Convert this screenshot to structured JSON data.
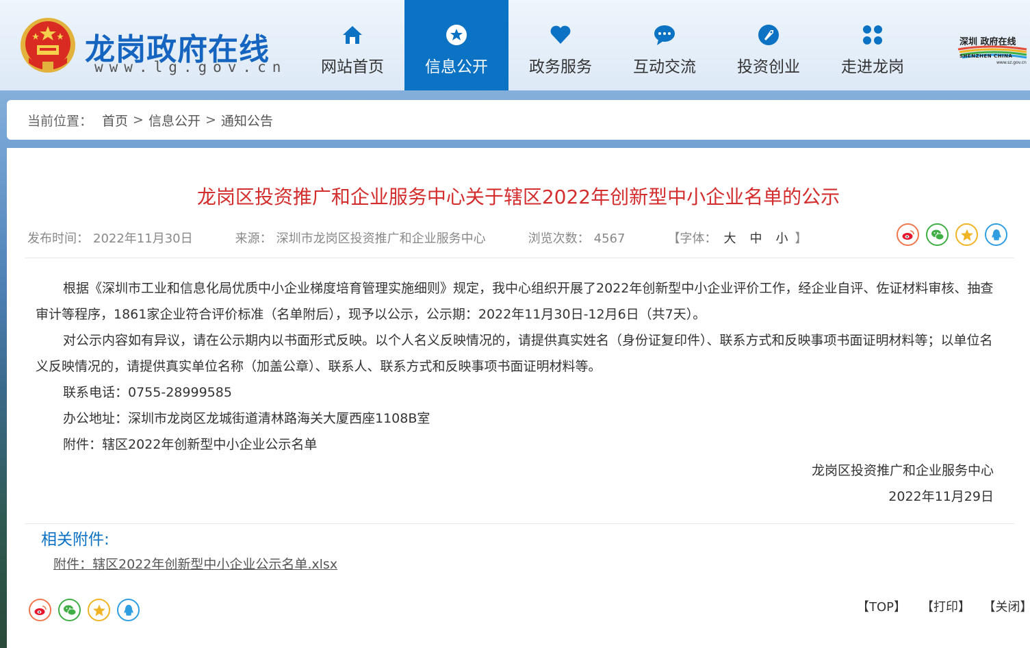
{
  "header": {
    "site_title": "龙岗政府在线",
    "site_url": "www.lg.gov.cn",
    "nav": [
      {
        "label": "网站首页",
        "icon": "home-icon",
        "active": false
      },
      {
        "label": "信息公开",
        "icon": "info-icon",
        "active": true
      },
      {
        "label": "政务服务",
        "icon": "heart-icon",
        "active": false
      },
      {
        "label": "互动交流",
        "icon": "chat-icon",
        "active": false
      },
      {
        "label": "投资创业",
        "icon": "rocket-icon",
        "active": false
      },
      {
        "label": "走进龙岗",
        "icon": "grid-icon",
        "active": false
      }
    ],
    "sz_logo": {
      "text1": "深圳 政府在线",
      "text2": "SHENZHEN CHINA",
      "text3": "www.sz.gov.cn"
    }
  },
  "breadcrumb": {
    "prefix": "当前位置：",
    "items": [
      "首页",
      "信息公开",
      "通知公告"
    ],
    "separator": ">"
  },
  "article": {
    "title": "龙岗区投资推广和企业服务中心关于辖区2022年创新型中小企业名单的公示",
    "publish_label": "发布时间：",
    "publish_date": "2022年11月30日",
    "source_label": "来源：",
    "source": "深圳市龙岗区投资推广和企业服务中心",
    "views_label": "浏览次数：",
    "views": "4567",
    "font_label": "【字体：",
    "font_large": "大",
    "font_medium": "中",
    "font_small": "小",
    "font_close": "】",
    "paragraphs": [
      "根据《深圳市工业和信息化局优质中小企业梯度培育管理实施细则》规定，我中心组织开展了2022年创新型中小企业评价工作，经企业自评、佐证材料审核、抽查审计等程序，1861家企业符合评价标准（名单附后），现予以公示，公示期：2022年11月30日-12月6日（共7天）。",
      "对公示内容如有异议，请在公示期内以书面形式反映。以个人名义反映情况的，请提供真实姓名（身份证复印件）、联系方式和反映事项书面证明材料等；以单位名义反映情况的，请提供真实单位名称（加盖公章）、联系人、联系方式和反映事项书面证明材料等。",
      "联系电话：0755-28999585",
      "办公地址：深圳市龙岗区龙城街道清林路海关大厦西座1108B室",
      "附件：辖区2022年创新型中小企业公示名单"
    ],
    "signature": "龙岗区投资推广和企业服务中心",
    "sign_date": "2022年11月29日"
  },
  "attachments": {
    "heading": "相关附件:",
    "items": [
      "附件：辖区2022年创新型中小企业公示名单.xlsx"
    ]
  },
  "bottom_links": {
    "top": "【TOP】",
    "print": "【打印】",
    "close": "【关闭】"
  },
  "colors": {
    "accent": "#0b72c4",
    "title_red": "#d32d2d",
    "weibo": "#f0764c",
    "wechat": "#3fae45",
    "star": "#f0b324",
    "qq": "#2f9ee0"
  }
}
